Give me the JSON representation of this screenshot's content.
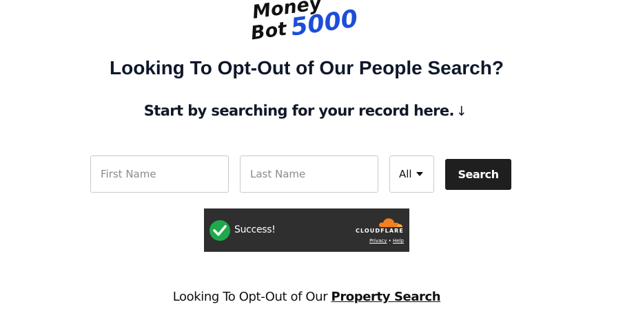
{
  "logo": {
    "line1": "Money",
    "line2": "Bot",
    "line3": "5000"
  },
  "heading": "Looking To Opt-Out of Our People Search?",
  "subheading": "Start by searching for your record here.",
  "subheading_arrow": "↓",
  "form": {
    "first_name_placeholder": "First Name",
    "last_name_placeholder": "Last Name",
    "first_name_value": "",
    "last_name_value": "",
    "state_selected": "All",
    "search_label": "Search"
  },
  "captcha": {
    "status": "Success!",
    "brand": "CLOUDFLARE",
    "privacy": "Privacy",
    "separator": "•",
    "help": "Help",
    "accent_color": "#f38020",
    "success_color": "#1fa94d"
  },
  "footer": {
    "prefix": "Looking To Opt-Out of Our",
    "link": "Property Search"
  },
  "colors": {
    "button_bg": "#1f1f1f",
    "logo_accent": "#1d4ed8"
  }
}
